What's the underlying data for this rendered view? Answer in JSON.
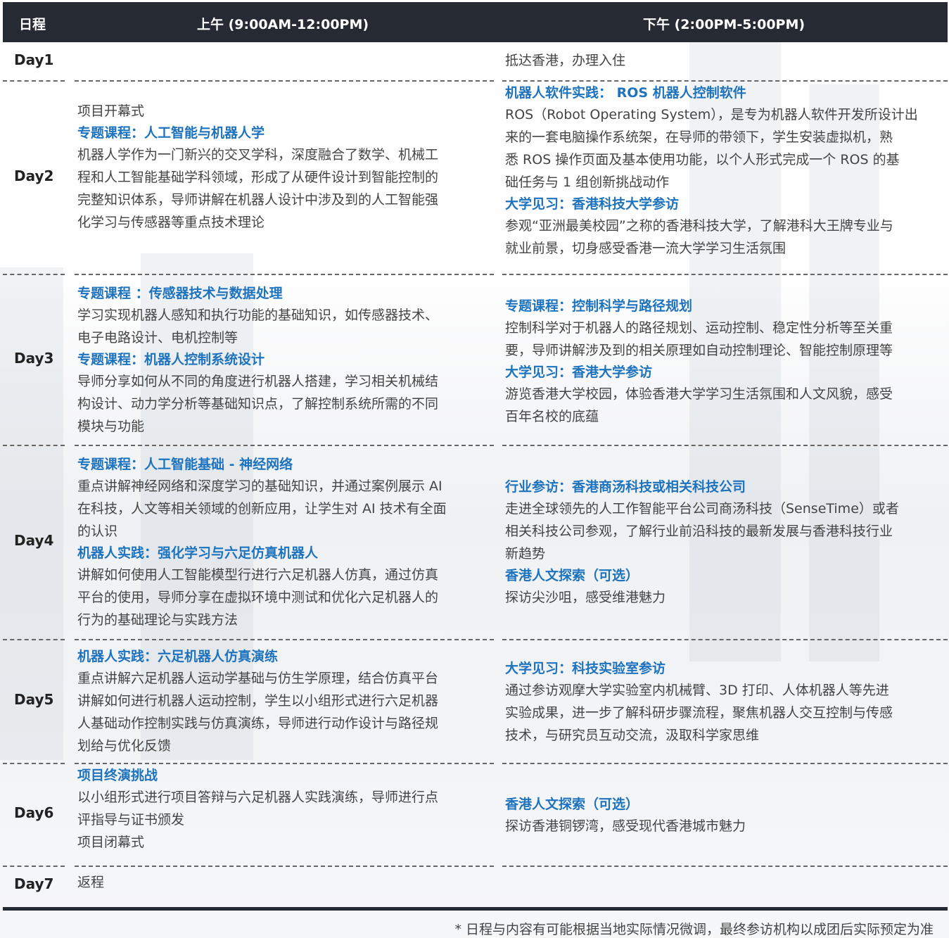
{
  "header": {
    "col_day": "日程",
    "col_am": "上午 (9:00AM-12:00PM)",
    "col_pm": "下午 (2:00PM-5:00PM)"
  },
  "days": [
    {
      "label": "Day1",
      "am": [],
      "pm": [
        {
          "title": "",
          "text": [
            "抵达香港，办理入住"
          ]
        }
      ]
    },
    {
      "label": "Day2",
      "am": [
        {
          "title": "",
          "text": [
            "项目开幕式"
          ]
        },
        {
          "title": "专题课程：人工智能与机器人学",
          "text": [
            "机器人学作为一门新兴的交叉学科，深度融合了数学、机械工",
            "程和人工智能基础学科领域，形成了从硬件设计到智能控制的",
            "完整知识体系，导师讲解在机器人设计中涉及到的人工智能强",
            "化学习与传感器等重点技术理论"
          ]
        }
      ],
      "pm": [
        {
          "title": "机器人软件实践： ROS 机器人控制软件",
          "text": [
            "ROS（Robot Operating System），是专为机器人软件开发所设计出",
            "来的一套电脑操作系统架，在导师的带领下，学生安装虚拟机，熟",
            "悉 ROS 操作页面及基本使用功能，以个人形式完成一个 ROS 的基",
            "础任务与 1 组创新挑战动作"
          ]
        },
        {
          "title": "大学见习：香港科技大学参访",
          "text": [
            "参观“亚洲最美校园”之称的香港科技大学，了解港科大王牌专业与",
            "就业前景，切身感受香港一流大学学习生活氛围"
          ]
        }
      ]
    },
    {
      "label": "Day3",
      "am": [
        {
          "title": "专题课程 ：传感器技术与数据处理",
          "text": [
            "学习实现机器人感知和执行功能的基础知识，如传感器技术、",
            "电子电路设计、电机控制等"
          ]
        },
        {
          "title": "专题课程：机器人控制系统设计",
          "text": [
            "导师分享如何从不同的角度进行机器人搭建，学习相关机械结",
            "构设计、动力学分析等基础知识点，了解控制系统所需的不同",
            "模块与功能"
          ]
        }
      ],
      "pm": [
        {
          "title": "专题课程：控制科学与路径规划",
          "text": [
            "控制科学对于机器人的路径规划、运动控制、稳定性分析等至关重",
            "要，导师讲解涉及到的相关原理如自动控制理论、智能控制原理等"
          ]
        },
        {
          "title": "大学见习：香港大学参访",
          "text": [
            "游览香港大学校园，体验香港大学学习生活氛围和人文风貌，感受",
            "百年名校的底蕴"
          ]
        }
      ]
    },
    {
      "label": "Day4",
      "am": [
        {
          "title": "专题课程：人工智能基础 - 神经网络",
          "text": [
            "重点讲解神经网络和深度学习的基础知识，并通过案例展示 AI",
            "在科技，人文等相关领域的创新应用，让学生对 AI 技术有全面",
            "的认识"
          ]
        },
        {
          "title": "机器人实践：强化学习与六足仿真机器人",
          "text": [
            "讲解如何使用人工智能模型行进行六足机器人仿真，通过仿真",
            "平台的使用，导师分享在虚拟环境中测试和优化六足机器人的",
            "行为的基础理论与实践方法"
          ]
        }
      ],
      "pm": [
        {
          "title": "行业参访：香港商汤科技或相关科技公司",
          "text": [
            "走进全球领先的人工作智能平台公司商汤科技（SenseTime）或者",
            "相关科技公司参观，了解行业前沿科技的最新发展与香港科技行业",
            "新趋势"
          ]
        },
        {
          "title": "香港人文探索（可选）",
          "text": [
            "探访尖沙咀，感受维港魅力"
          ]
        }
      ]
    },
    {
      "label": "Day5",
      "am": [
        {
          "title": "机器人实践：六足机器人仿真演练",
          "text": [
            "重点讲解六足机器人运动学基础与仿生学原理，结合仿真平台",
            "讲解如何进行机器人运动控制，学生以小组形式进行六足机器",
            "人基础动作控制实践与仿真演练，导师进行动作设计与路径规",
            "划给与优化反馈"
          ]
        }
      ],
      "pm": [
        {
          "title": "大学见习：科技实验室参访",
          "text": [
            "通过参访观摩大学实验室内机械臂、3D 打印、人体机器人等先进",
            "实验成果，进一步了解科研步骤流程，聚焦机器人交互控制与传感",
            "技术，与研究员互动交流，汲取科学家思维"
          ]
        }
      ]
    },
    {
      "label": "Day6",
      "am": [
        {
          "title": "项目终演挑战",
          "text": [
            "以小组形式进行项目答辩与六足机器人实践演练，导师进行点",
            "评指导与证书颁发",
            "项目闭幕式"
          ]
        }
      ],
      "pm": [
        {
          "title": "香港人文探索（可选）",
          "text": [
            "探访香港铜锣湾，感受现代香港城市魅力"
          ]
        }
      ]
    },
    {
      "label": "Day7",
      "am": [
        {
          "title": "",
          "text": [
            "返程"
          ]
        }
      ],
      "pm": []
    }
  ],
  "footnote": "* 日程与内容有可能根据当地实际情况微调，最终参访机构以成团后实际预定为准"
}
